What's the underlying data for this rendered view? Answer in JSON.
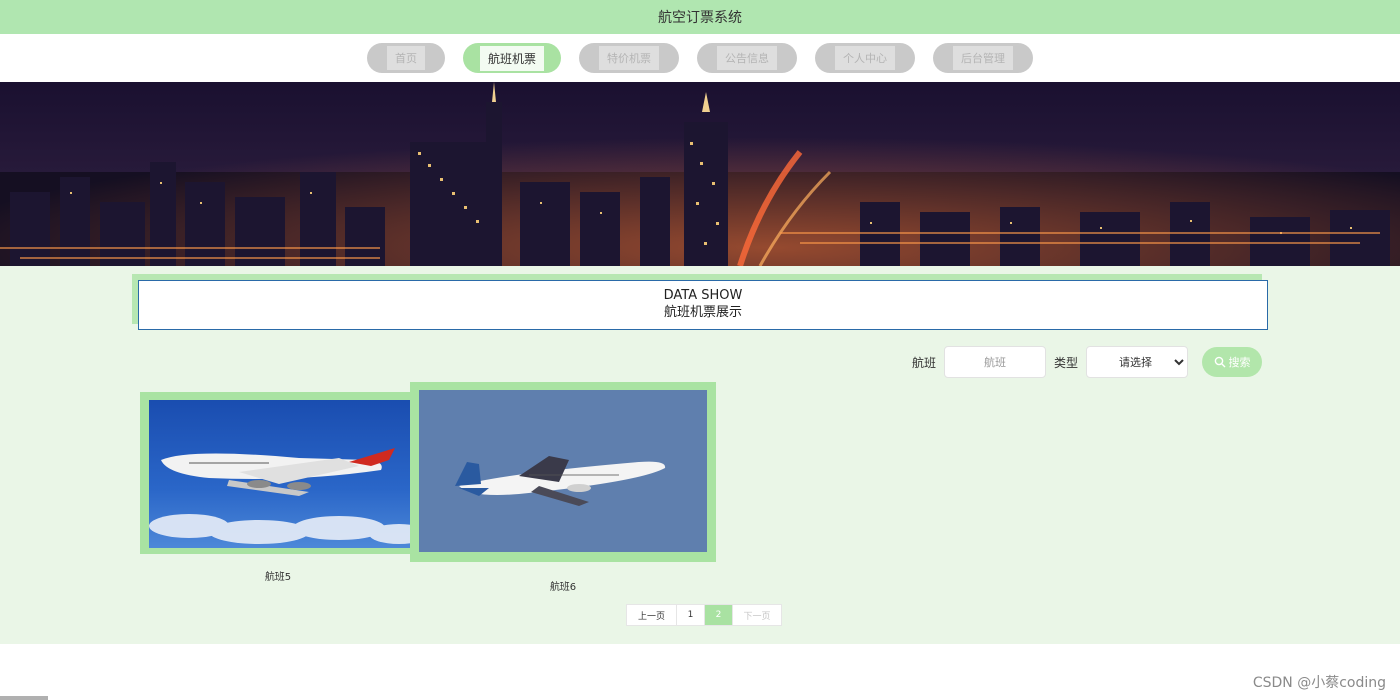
{
  "app": {
    "title": "航空订票系统"
  },
  "nav": {
    "items": [
      {
        "label": "首页"
      },
      {
        "label": "航班机票"
      },
      {
        "label": "特价机票"
      },
      {
        "label": "公告信息"
      },
      {
        "label": "个人中心"
      },
      {
        "label": "后台管理"
      }
    ],
    "active_index": 1
  },
  "section": {
    "title_en": "DATA SHOW",
    "title_cn": "航班机票展示"
  },
  "search": {
    "flight_label": "航班",
    "flight_placeholder": "航班",
    "type_label": "类型",
    "type_selected": "请选择",
    "button_label": "搜索"
  },
  "cards": [
    {
      "caption": "航班5"
    },
    {
      "caption": "航班6"
    }
  ],
  "pager": {
    "prev": "上一页",
    "page1": "1",
    "page2": "2",
    "next": "下一页",
    "current": "2"
  },
  "watermark": "CSDN @小蔡coding",
  "colors": {
    "accent": "#a9e2a2",
    "header": "#b0e6b0",
    "content_bg": "#eaf6e7"
  }
}
